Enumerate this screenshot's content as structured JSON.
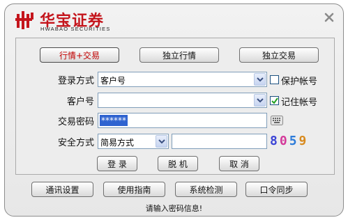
{
  "brand": {
    "name_cn": "华宝证券",
    "name_en": "HWABAO SECURITIES",
    "color": "#c4151c"
  },
  "tabs": [
    {
      "label": "行情+交易",
      "active": true
    },
    {
      "label": "独立行情",
      "active": false
    },
    {
      "label": "独立交易",
      "active": false
    }
  ],
  "form": {
    "login_method": {
      "label": "登录方式",
      "value": "客户号"
    },
    "account": {
      "label": "客户号",
      "value": ""
    },
    "password": {
      "label": "交易密码",
      "masked": "******"
    },
    "security": {
      "label": "安全方式",
      "value": "简易方式",
      "input_value": ""
    },
    "save_account": {
      "label": "保护帐号",
      "checked": false
    },
    "remember_account": {
      "label": "记住帐号",
      "checked": true
    },
    "captcha": [
      "8",
      "0",
      "5",
      "9"
    ],
    "captcha_colors": [
      "#3b44d6",
      "#d43a9a",
      "#2c7bd9",
      "#d88a1e"
    ]
  },
  "actions": {
    "login": "登 录",
    "offline": "脱 机",
    "cancel": "取 消"
  },
  "footer_buttons": [
    "通讯设置",
    "使用指南",
    "系统检测",
    "口令同步"
  ],
  "status": "请输入密码信息!"
}
